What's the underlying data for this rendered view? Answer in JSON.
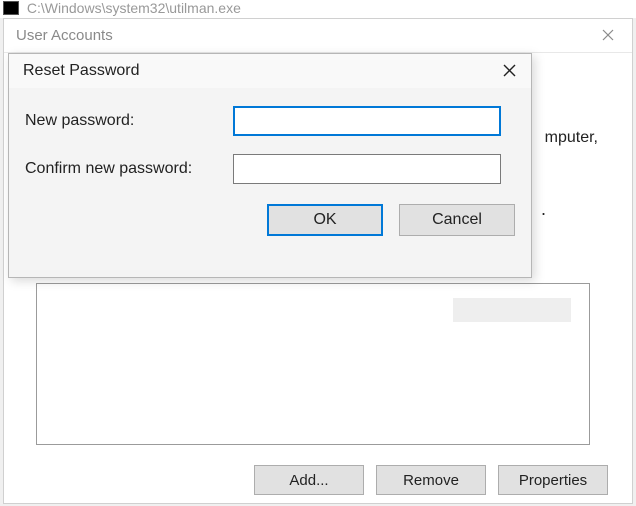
{
  "cmd": {
    "title": "C:\\Windows\\system32\\utilman.exe"
  },
  "ua": {
    "title": "User Accounts",
    "body_fragment_right": "mputer,",
    "body_fragment_dot": ".",
    "buttons": {
      "add": "Add...",
      "remove": "Remove",
      "properties": "Properties"
    }
  },
  "modal": {
    "title": "Reset Password",
    "labels": {
      "new_password": "New password:",
      "confirm_password": "Confirm new password:"
    },
    "values": {
      "new_password": "",
      "confirm_password": ""
    },
    "buttons": {
      "ok": "OK",
      "cancel": "Cancel"
    }
  }
}
